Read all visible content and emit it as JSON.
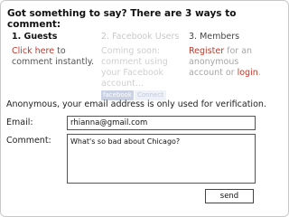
{
  "heading": "Got something to say? There are 3 ways to comment:",
  "columns": {
    "guests": {
      "title": "1. Guests",
      "link": "Click here",
      "text_after": " to comment instantly."
    },
    "facebook": {
      "title": "2. Facebook Users",
      "text": "Coming soon: comment using your Facebook account...",
      "badge": "facebook",
      "connect": "Connect"
    },
    "members": {
      "title": "3. Members",
      "register_link": "Register",
      "text_mid": " for an anonymous account or ",
      "login_link": "login",
      "text_end": "."
    }
  },
  "verification_note": "Anonymous, your email address is only used for verification.",
  "form": {
    "email_label": "Email:",
    "email_value": "rhianna@gmail.com",
    "comment_label": "Comment:",
    "comment_value": "What's so bad about Chicago?",
    "send_label": "send"
  },
  "colors": {
    "link": "#c0392b",
    "muted": "#cfcfcf"
  }
}
